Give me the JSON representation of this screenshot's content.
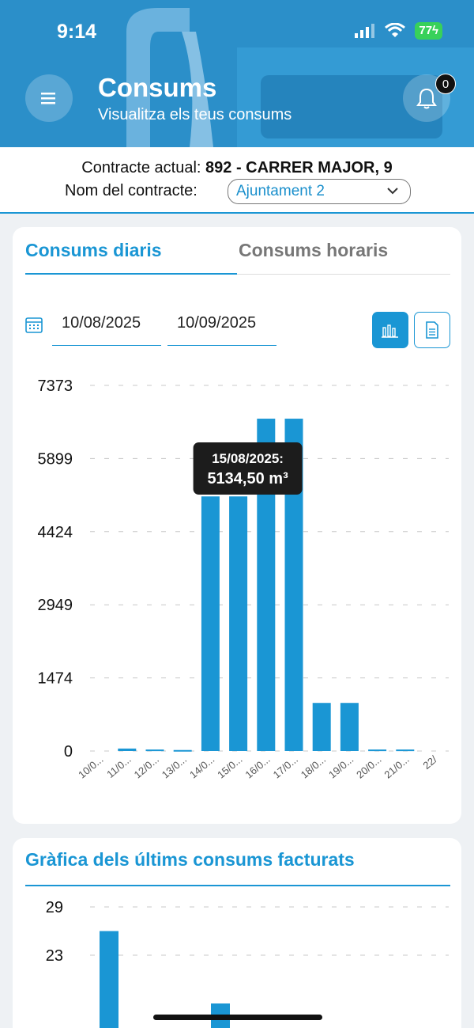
{
  "status": {
    "time": "9:14",
    "battery": "77"
  },
  "header": {
    "title": "Consums",
    "subtitle": "Visualitza els teus consums",
    "notifications_count": "0",
    "menu_icon": "hamburger-icon",
    "bell_icon": "bell-icon"
  },
  "contract": {
    "label": "Contracte actual:",
    "value": "892 -  CARRER MAJOR, 9",
    "name_label": "Nom del contracte:",
    "name_value": "Ajuntament 2"
  },
  "tabs": [
    {
      "label": "Consums diaris",
      "active": true
    },
    {
      "label": "Consums horaris",
      "active": false
    }
  ],
  "date_range": {
    "from": "10/08/2025",
    "to": "10/09/2025"
  },
  "colors": {
    "accent": "#1a96d4",
    "bar": "#1a96d4"
  },
  "billing": {
    "title": "Gràfica dels últims consums facturats"
  },
  "chart_data": [
    {
      "type": "bar",
      "categories": [
        "10/0...",
        "11/0...",
        "12/0...",
        "13/0...",
        "14/0...",
        "15/0...",
        "16/0...",
        "17/0...",
        "18/0...",
        "19/0...",
        "20/0...",
        "21/0...",
        "22/"
      ],
      "values": [
        0,
        50,
        30,
        20,
        5134.5,
        5134.5,
        6702,
        6702,
        970,
        970,
        30,
        30,
        0
      ],
      "yticks": [
        0,
        1474,
        2949,
        4424,
        5899,
        7373
      ],
      "ylim": [
        0,
        7373
      ],
      "grid": true,
      "tooltip": {
        "category_index": 5,
        "line1": "15/08/2025:",
        "line2": "5134,50 m³"
      }
    },
    {
      "type": "bar",
      "categories": [
        "",
        "",
        "",
        "",
        ""
      ],
      "values": [
        26,
        0,
        0,
        0,
        17
      ],
      "yticks": [
        23,
        29
      ],
      "grid": true
    }
  ]
}
